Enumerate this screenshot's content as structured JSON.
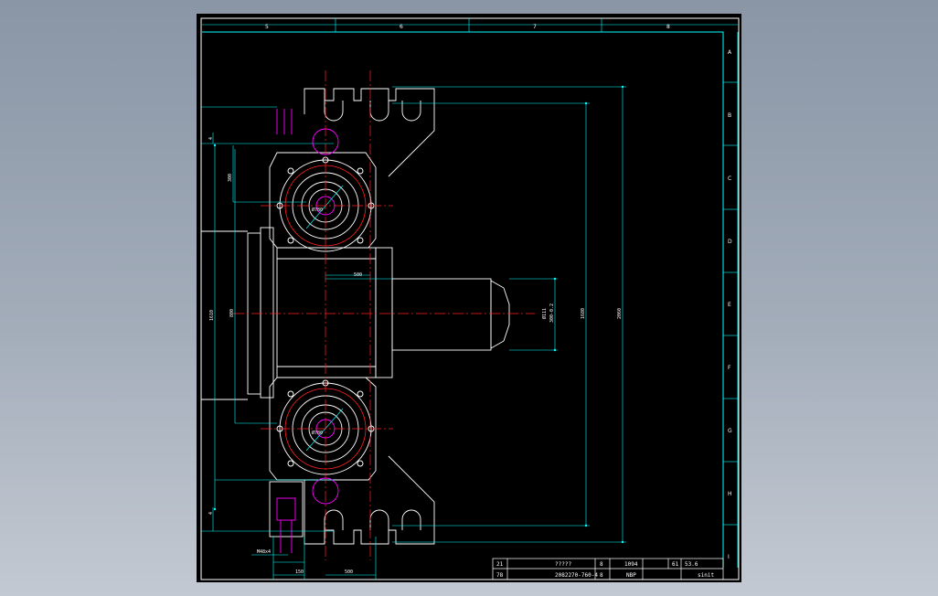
{
  "colors": {
    "background": "#000000",
    "frame": "#ffffff",
    "border": "#00ffff",
    "part": "#ffffff",
    "dimension": "#00ffff",
    "centerline": "#ff2020",
    "hidden": "#ff00ff",
    "accent": "#00ff00",
    "window_bg": "#8a96a6"
  },
  "drawing": {
    "column_labels": [
      "5",
      "6",
      "7",
      "8"
    ],
    "row_labels": [
      "A",
      "B",
      "C",
      "D",
      "E",
      "F",
      "G",
      "H",
      "I"
    ],
    "dimensions": {
      "left_top_gap": "4",
      "left_upper": "300",
      "left_total": "1610",
      "left_mid": "800",
      "left_bottom_gap": "4",
      "shaft_len": "500",
      "right_inner": "1680",
      "right_outer": "2060",
      "shaft_dia": "Ø111",
      "shaft_tol": "300-0.2",
      "bottom_a": "500",
      "bottom_b": "150",
      "bolt_spec": "M48x4",
      "bore_top": "Ø780",
      "bore_bottom": "Ø780"
    }
  },
  "title_block": {
    "row1": [
      "21",
      "?????",
      "8",
      "1094",
      "61",
      "53.6"
    ],
    "row2": [
      "78",
      "2082270-760-4",
      "8",
      "NBP",
      "",
      "sinit"
    ]
  }
}
